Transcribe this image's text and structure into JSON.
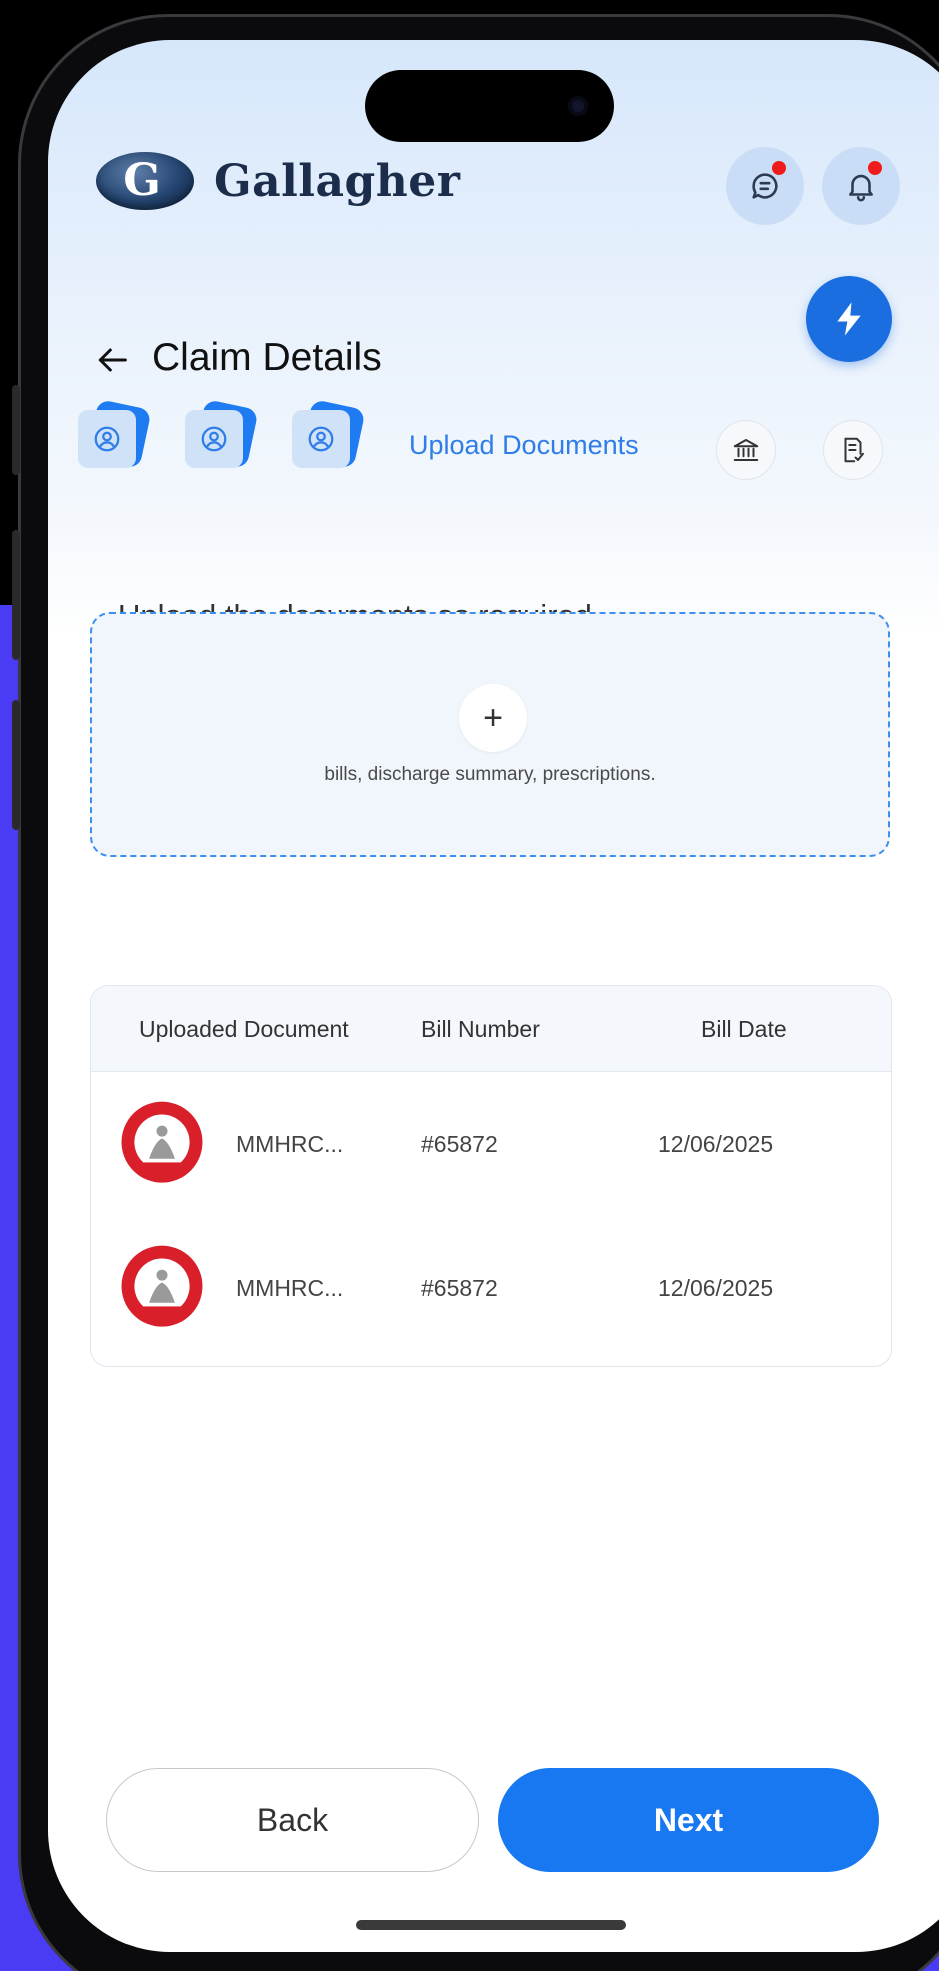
{
  "app": {
    "brand": "Gallagher",
    "logo_letter": "G"
  },
  "header": {
    "chat_icon": "chat-icon",
    "bell_icon": "bell-icon",
    "chat_has_unread": true,
    "bell_has_unread": true
  },
  "page": {
    "title": "Claim Details"
  },
  "stepper": {
    "active_label": "Upload Documents",
    "steps": [
      {
        "icon": "user-circle-icon",
        "status": "done"
      },
      {
        "icon": "user-circle-icon",
        "status": "done"
      },
      {
        "icon": "user-circle-icon",
        "status": "done"
      },
      {
        "icon": "upload-documents",
        "status": "active"
      },
      {
        "icon": "bank-icon",
        "status": "pending"
      },
      {
        "icon": "document-check-icon",
        "status": "pending"
      }
    ]
  },
  "upload": {
    "title": "Upload the documents as required",
    "hint": "bills, discharge summary, prescriptions.",
    "plus": "+"
  },
  "table": {
    "headers": [
      "Uploaded Document",
      "Bill Number",
      "Bill Date"
    ],
    "rows": [
      {
        "document": "MMHRC...",
        "bill_number": "#65872",
        "bill_date": "12/06/2025"
      },
      {
        "document": "MMHRC...",
        "bill_number": "#65872",
        "bill_date": "12/06/2025"
      }
    ]
  },
  "actions": {
    "back_label": "Back",
    "next_label": "Next"
  },
  "colors": {
    "primary": "#1778f2",
    "badge_red": "#ef1b1b",
    "side_purple": "#4a3cf5"
  }
}
